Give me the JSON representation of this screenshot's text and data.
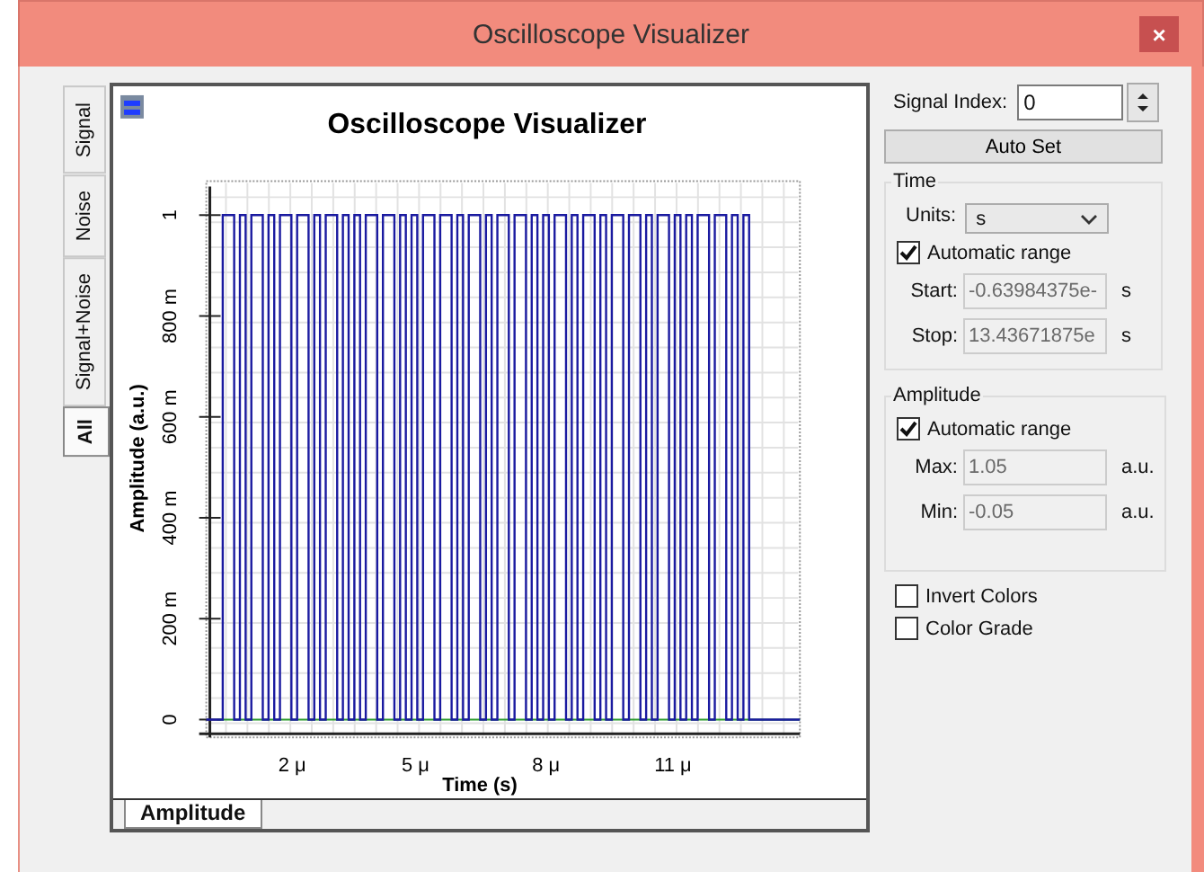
{
  "window": {
    "title": "Oscilloscope Visualizer",
    "close": "×"
  },
  "side_tabs": [
    {
      "label": "Signal",
      "selected": false
    },
    {
      "label": "Noise",
      "selected": false
    },
    {
      "label": "Signal+Noise",
      "selected": false
    },
    {
      "label": "All",
      "selected": true
    }
  ],
  "plot": {
    "title": "Oscilloscope Visualizer",
    "ylabel": "Amplitude (a.u.)",
    "xlabel": "Time (s)",
    "yticks": [
      "0",
      "200 m",
      "400 m",
      "600 m",
      "800 m",
      "1"
    ],
    "xticks": [
      "2 μ",
      "5 μ",
      "8 μ",
      "11 μ"
    ]
  },
  "bottom_tabs": [
    {
      "label": "Amplitude",
      "selected": true
    }
  ],
  "signal_index": {
    "label": "Signal Index:",
    "value": "0"
  },
  "auto_set": "Auto Set",
  "time": {
    "title": "Time",
    "units_label": "Units:",
    "units": "s",
    "auto_range": {
      "label": "Automatic range",
      "checked": true
    },
    "fields": [
      {
        "label": "Start:",
        "value": "-0.63984375e-",
        "unit": "s",
        "disabled": true
      },
      {
        "label": "Stop:",
        "value": "13.43671875e",
        "unit": "s",
        "disabled": true
      }
    ]
  },
  "amplitude": {
    "title": "Amplitude",
    "auto_range": {
      "label": "Automatic range",
      "checked": true
    },
    "fields": [
      {
        "label": "Max:",
        "value": "1.05",
        "unit": "a.u.",
        "disabled": true
      },
      {
        "label": "Min:",
        "value": "-0.05",
        "unit": "a.u.",
        "disabled": true
      }
    ]
  },
  "options": [
    {
      "label": "Invert Colors",
      "checked": false
    },
    {
      "label": "Color Grade",
      "checked": false
    }
  ]
}
